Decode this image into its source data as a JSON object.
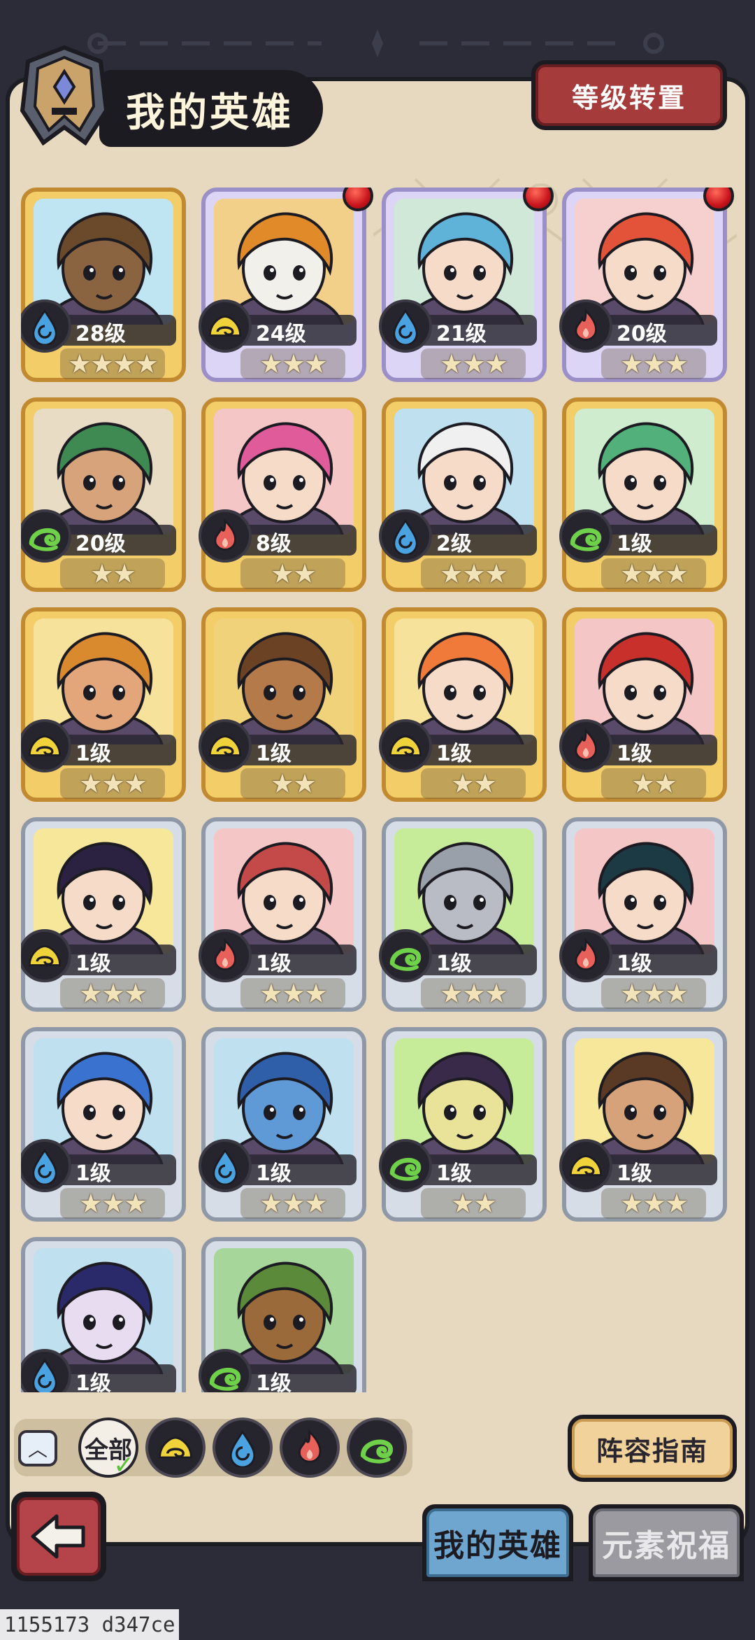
{
  "header": {
    "title": "我的英雄",
    "level_reset_label": "等级转置"
  },
  "heroes": [
    {
      "level": "28级",
      "stars": "★★★★",
      "element": "water",
      "frame": "gold",
      "alert": false,
      "bg": "#bfe4f2",
      "skin": "#8a6440",
      "hair": "#6b4a2c"
    },
    {
      "level": "24级",
      "stars": "★★★",
      "element": "light",
      "frame": "purple",
      "alert": true,
      "bg": "#f3d08a",
      "skin": "#f2f0ea",
      "hair": "#e08a2a"
    },
    {
      "level": "21级",
      "stars": "★★★",
      "element": "water",
      "frame": "purple",
      "alert": true,
      "bg": "#cfe8d8",
      "skin": "#f6dcc8",
      "hair": "#5fb3d8"
    },
    {
      "level": "20级",
      "stars": "★★★",
      "element": "fire",
      "frame": "purple",
      "alert": true,
      "bg": "#f6cfcf",
      "skin": "#f6dcc8",
      "hair": "#e2533a"
    },
    {
      "level": "20级",
      "stars": "★★",
      "element": "wind",
      "frame": "gold",
      "alert": false,
      "bg": "#e8dcc4",
      "skin": "#d7a37a",
      "hair": "#3f8a52"
    },
    {
      "level": "8级",
      "stars": "★★",
      "element": "fire",
      "frame": "gold",
      "alert": false,
      "bg": "#f4c6c6",
      "skin": "#f6dcc8",
      "hair": "#e05b9a"
    },
    {
      "level": "2级",
      "stars": "★★★",
      "element": "water",
      "frame": "gold",
      "alert": false,
      "bg": "#bfe0ee",
      "skin": "#f6dcc8",
      "hair": "#f0f0f0"
    },
    {
      "level": "1级",
      "stars": "★★★",
      "element": "wind",
      "frame": "gold",
      "alert": false,
      "bg": "#cfeccf",
      "skin": "#f6dcc8",
      "hair": "#52b07a"
    },
    {
      "level": "1级",
      "stars": "★★★",
      "element": "light",
      "frame": "gold",
      "alert": false,
      "bg": "#f6e29a",
      "skin": "#e2a67a",
      "hair": "#d98a2e"
    },
    {
      "level": "1级",
      "stars": "★★",
      "element": "light",
      "frame": "gold",
      "alert": false,
      "bg": "#f0d27a",
      "skin": "#b57a4a",
      "hair": "#6b4224"
    },
    {
      "level": "1级",
      "stars": "★★",
      "element": "light",
      "frame": "gold",
      "alert": false,
      "bg": "#f6e29a",
      "skin": "#f6dcc8",
      "hair": "#ef7a3a"
    },
    {
      "level": "1级",
      "stars": "★★",
      "element": "fire",
      "frame": "gold",
      "alert": false,
      "bg": "#f4c6c6",
      "skin": "#f6dcc8",
      "hair": "#c8302c"
    },
    {
      "level": "1级",
      "stars": "★★★",
      "element": "light",
      "frame": "silver",
      "alert": false,
      "bg": "#f6e79a",
      "skin": "#f6dcc8",
      "hair": "#2a2240"
    },
    {
      "level": "1级",
      "stars": "★★★",
      "element": "fire",
      "frame": "silver",
      "alert": false,
      "bg": "#f4c6c6",
      "skin": "#f6dcc8",
      "hair": "#c44a4a"
    },
    {
      "level": "1级",
      "stars": "★★★",
      "element": "wind",
      "frame": "silver",
      "alert": false,
      "bg": "#c6ec9a",
      "skin": "#b9bcc4",
      "hair": "#9aa0aa"
    },
    {
      "level": "1级",
      "stars": "★★★",
      "element": "fire",
      "frame": "silver",
      "alert": false,
      "bg": "#f4c6c6",
      "skin": "#f6dcc8",
      "hair": "#1c3a44"
    },
    {
      "level": "1级",
      "stars": "★★★",
      "element": "water",
      "frame": "silver",
      "alert": false,
      "bg": "#bfe0ee",
      "skin": "#f6dcc8",
      "hair": "#3a72d0"
    },
    {
      "level": "1级",
      "stars": "★★★",
      "element": "water",
      "frame": "silver",
      "alert": false,
      "bg": "#bfe0ee",
      "skin": "#5f9ad6",
      "hair": "#2f5fa8"
    },
    {
      "level": "1级",
      "stars": "★★",
      "element": "wind",
      "frame": "silver",
      "alert": false,
      "bg": "#c6ec9a",
      "skin": "#e9e39a",
      "hair": "#3a2a4a"
    },
    {
      "level": "1级",
      "stars": "★★★",
      "element": "light",
      "frame": "silver",
      "alert": false,
      "bg": "#f6e79a",
      "skin": "#d6a27a",
      "hair": "#5a3a24"
    },
    {
      "level": "1级",
      "stars": "",
      "element": "water",
      "frame": "silver",
      "alert": false,
      "bg": "#bfe0ee",
      "skin": "#e8dcf0",
      "hair": "#2a2a6a"
    },
    {
      "level": "1级",
      "stars": "",
      "element": "wind",
      "frame": "silver",
      "alert": false,
      "bg": "#a6d69a",
      "skin": "#9a6a3a",
      "hair": "#5a8a3a"
    }
  ],
  "filters": {
    "all_label": "全部",
    "items": [
      "light",
      "water",
      "fire",
      "wind"
    ]
  },
  "guide_label": "阵容指南",
  "tabs": {
    "my_heroes": "我的英雄",
    "element_blessing": "元素祝福"
  },
  "watermark": "1155173 d347ce",
  "colors": {
    "water": "#4aa3e0",
    "fire": "#e8605a",
    "wind": "#6fd04a",
    "light": "#f0d23a"
  }
}
